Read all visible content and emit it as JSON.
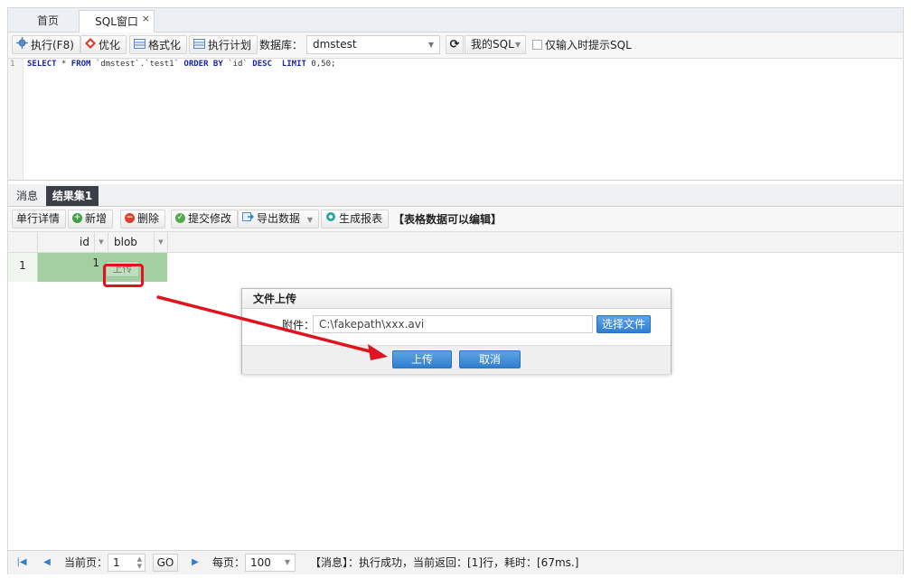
{
  "tabs": {
    "home": "首页",
    "sql": "SQL窗口",
    "close": "×"
  },
  "toolbar": {
    "execute": "执行(F8)",
    "optimize": "优化",
    "format": "格式化",
    "plan": "执行计划",
    "db_label": "数据库：",
    "db_value": "dmstest",
    "mysql": "我的SQL",
    "hint_only": "仅输入时提示SQL"
  },
  "editor": {
    "line": "1",
    "sql": {
      "k1": "SELECT",
      "p1": " * ",
      "k2": "FROM",
      "p2": " `dmstest`.`test1` ",
      "k3": "ORDER BY",
      "p3": " `id` ",
      "k4": "DESC",
      "p4": "  ",
      "k5": "LIMIT",
      "p5": " 0,50;"
    }
  },
  "result_tabs": {
    "messages": "消息",
    "result1": "结果集1"
  },
  "result_toolbar": {
    "detail": "单行详情",
    "add": "新增",
    "delete": "删除",
    "submit": "提交修改",
    "export": "导出数据",
    "report": "生成报表",
    "note": "【表格数据可以编辑】"
  },
  "grid": {
    "columns": [
      "id",
      "blob"
    ],
    "rows": [
      {
        "num": "1",
        "id": "1",
        "blob": "上传"
      }
    ]
  },
  "dialog": {
    "title": "文件上传",
    "attach_label": "附件：",
    "file_path": "C:\\fakepath\\xxx.avi",
    "choose": "选择文件",
    "upload": "上传",
    "cancel": "取消"
  },
  "pager": {
    "current_label": "当前页：",
    "current_page": "1",
    "go": "GO",
    "per_page_label": "每页：",
    "per_page": "100",
    "message": "【消息】：执行成功，当前返回：[1]行，耗时：[67ms.]"
  },
  "colors": {
    "accent": "#2f7fd0",
    "selected_row": "#a3cfa3",
    "highlight": "#e0141e"
  }
}
